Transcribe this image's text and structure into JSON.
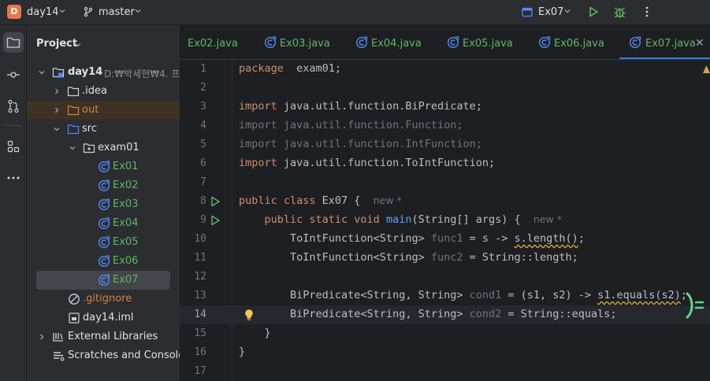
{
  "titlebar": {
    "project_badge": "D",
    "project_name": "day14",
    "branch": "master",
    "run_config": "Ex07"
  },
  "panel": {
    "title": "Project",
    "root": {
      "name": "day14",
      "path": "D:₩박세현₩4. 프"
    },
    "items": [
      {
        "label": ".idea"
      },
      {
        "label": "out"
      },
      {
        "label": "src"
      },
      {
        "label": "exam01"
      },
      {
        "label": "Ex01"
      },
      {
        "label": "Ex02"
      },
      {
        "label": "Ex03"
      },
      {
        "label": "Ex04"
      },
      {
        "label": "Ex05"
      },
      {
        "label": "Ex06"
      },
      {
        "label": "Ex07"
      },
      {
        "label": ".gitignore"
      },
      {
        "label": "day14.iml"
      },
      {
        "label": "External Libraries"
      },
      {
        "label": "Scratches and Consoles"
      }
    ]
  },
  "tabs": [
    {
      "label": "Ex02.java"
    },
    {
      "label": "Ex03.java"
    },
    {
      "label": "Ex04.java"
    },
    {
      "label": "Ex05.java"
    },
    {
      "label": "Ex06.java"
    },
    {
      "label": "Ex07.java",
      "active": true
    }
  ],
  "editor": {
    "current_line": 14,
    "lines": [
      {
        "n": "1",
        "t": [
          [
            "kw",
            "package"
          ],
          [
            "",
            "  exam01;"
          ]
        ]
      },
      {
        "n": "2",
        "t": []
      },
      {
        "n": "3",
        "t": [
          [
            "kw",
            "import"
          ],
          [
            "",
            " java.util.function.BiPredicate;"
          ]
        ]
      },
      {
        "n": "4",
        "t": [
          [
            "dim",
            "import java.util.function.Function;"
          ]
        ]
      },
      {
        "n": "5",
        "t": [
          [
            "dim",
            "import java.util.function.IntFunction;"
          ]
        ]
      },
      {
        "n": "6",
        "t": [
          [
            "kw",
            "import"
          ],
          [
            "",
            " java.util.function.ToIntFunction;"
          ]
        ]
      },
      {
        "n": "7",
        "t": []
      },
      {
        "n": "8",
        "t": [
          [
            "kw",
            "public class "
          ],
          [
            "",
            "Ex07 {  "
          ],
          [
            "ann",
            "new *"
          ]
        ]
      },
      {
        "n": "9",
        "t": [
          [
            "",
            "    "
          ],
          [
            "kw",
            "public static void "
          ],
          [
            "fn",
            "main"
          ],
          [
            "",
            "(String[] args) {  "
          ],
          [
            "ann",
            "new *"
          ]
        ]
      },
      {
        "n": "10",
        "t": [
          [
            "",
            "        ToIntFunction<String> "
          ],
          [
            "dim",
            "func1"
          ],
          [
            "",
            " = s -> "
          ],
          [
            "wavy",
            "s.length()"
          ],
          [
            "",
            ";"
          ]
        ]
      },
      {
        "n": "11",
        "t": [
          [
            "",
            "        ToIntFunction<String> "
          ],
          [
            "dim",
            "func2"
          ],
          [
            "",
            " = String::length;"
          ]
        ]
      },
      {
        "n": "12",
        "t": []
      },
      {
        "n": "13",
        "t": [
          [
            "",
            "        BiPredicate<String, String> "
          ],
          [
            "dim",
            "cond1"
          ],
          [
            "",
            " = (s1, s2) -> "
          ],
          [
            "wavy",
            "s1.equals(s2)"
          ],
          [
            "",
            ";"
          ]
        ]
      },
      {
        "n": "14",
        "t": [
          [
            "",
            "        BiPredicate<String, String> "
          ],
          [
            "dim",
            "cond2"
          ],
          [
            "",
            " = String::equals;"
          ]
        ]
      },
      {
        "n": "15",
        "t": [
          [
            "",
            "    }"
          ]
        ]
      },
      {
        "n": "16",
        "t": [
          [
            "",
            "}"
          ]
        ]
      },
      {
        "n": "17",
        "t": []
      }
    ]
  },
  "colors": {
    "accent": "#3574f0",
    "keyword": "#cf8e6d",
    "modified_file": "#5fb865",
    "excluded_folder": "#d4843e"
  }
}
